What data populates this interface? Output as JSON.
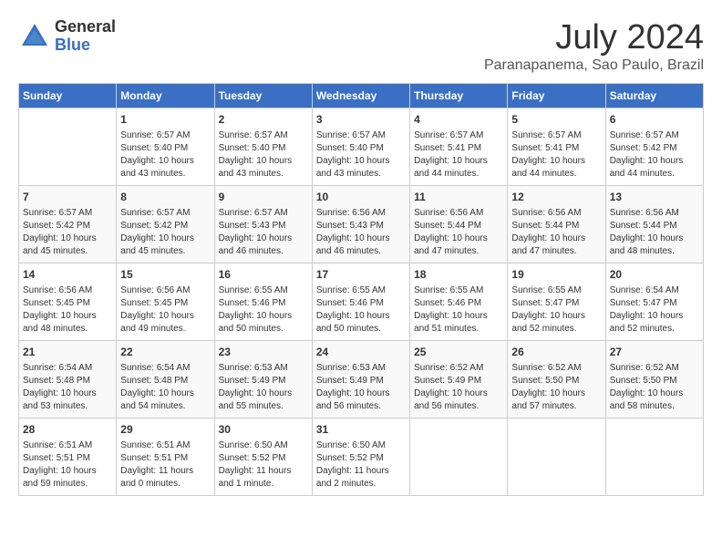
{
  "header": {
    "logo_general": "General",
    "logo_blue": "Blue",
    "month_year": "July 2024",
    "location": "Paranapanema, Sao Paulo, Brazil"
  },
  "days_of_week": [
    "Sunday",
    "Monday",
    "Tuesday",
    "Wednesday",
    "Thursday",
    "Friday",
    "Saturday"
  ],
  "weeks": [
    [
      {
        "day": "",
        "info": ""
      },
      {
        "day": "1",
        "info": "Sunrise: 6:57 AM\nSunset: 5:40 PM\nDaylight: 10 hours\nand 43 minutes."
      },
      {
        "day": "2",
        "info": "Sunrise: 6:57 AM\nSunset: 5:40 PM\nDaylight: 10 hours\nand 43 minutes."
      },
      {
        "day": "3",
        "info": "Sunrise: 6:57 AM\nSunset: 5:40 PM\nDaylight: 10 hours\nand 43 minutes."
      },
      {
        "day": "4",
        "info": "Sunrise: 6:57 AM\nSunset: 5:41 PM\nDaylight: 10 hours\nand 44 minutes."
      },
      {
        "day": "5",
        "info": "Sunrise: 6:57 AM\nSunset: 5:41 PM\nDaylight: 10 hours\nand 44 minutes."
      },
      {
        "day": "6",
        "info": "Sunrise: 6:57 AM\nSunset: 5:42 PM\nDaylight: 10 hours\nand 44 minutes."
      }
    ],
    [
      {
        "day": "7",
        "info": "Sunrise: 6:57 AM\nSunset: 5:42 PM\nDaylight: 10 hours\nand 45 minutes."
      },
      {
        "day": "8",
        "info": "Sunrise: 6:57 AM\nSunset: 5:42 PM\nDaylight: 10 hours\nand 45 minutes."
      },
      {
        "day": "9",
        "info": "Sunrise: 6:57 AM\nSunset: 5:43 PM\nDaylight: 10 hours\nand 46 minutes."
      },
      {
        "day": "10",
        "info": "Sunrise: 6:56 AM\nSunset: 5:43 PM\nDaylight: 10 hours\nand 46 minutes."
      },
      {
        "day": "11",
        "info": "Sunrise: 6:56 AM\nSunset: 5:44 PM\nDaylight: 10 hours\nand 47 minutes."
      },
      {
        "day": "12",
        "info": "Sunrise: 6:56 AM\nSunset: 5:44 PM\nDaylight: 10 hours\nand 47 minutes."
      },
      {
        "day": "13",
        "info": "Sunrise: 6:56 AM\nSunset: 5:44 PM\nDaylight: 10 hours\nand 48 minutes."
      }
    ],
    [
      {
        "day": "14",
        "info": "Sunrise: 6:56 AM\nSunset: 5:45 PM\nDaylight: 10 hours\nand 48 minutes."
      },
      {
        "day": "15",
        "info": "Sunrise: 6:56 AM\nSunset: 5:45 PM\nDaylight: 10 hours\nand 49 minutes."
      },
      {
        "day": "16",
        "info": "Sunrise: 6:55 AM\nSunset: 5:46 PM\nDaylight: 10 hours\nand 50 minutes."
      },
      {
        "day": "17",
        "info": "Sunrise: 6:55 AM\nSunset: 5:46 PM\nDaylight: 10 hours\nand 50 minutes."
      },
      {
        "day": "18",
        "info": "Sunrise: 6:55 AM\nSunset: 5:46 PM\nDaylight: 10 hours\nand 51 minutes."
      },
      {
        "day": "19",
        "info": "Sunrise: 6:55 AM\nSunset: 5:47 PM\nDaylight: 10 hours\nand 52 minutes."
      },
      {
        "day": "20",
        "info": "Sunrise: 6:54 AM\nSunset: 5:47 PM\nDaylight: 10 hours\nand 52 minutes."
      }
    ],
    [
      {
        "day": "21",
        "info": "Sunrise: 6:54 AM\nSunset: 5:48 PM\nDaylight: 10 hours\nand 53 minutes."
      },
      {
        "day": "22",
        "info": "Sunrise: 6:54 AM\nSunset: 5:48 PM\nDaylight: 10 hours\nand 54 minutes."
      },
      {
        "day": "23",
        "info": "Sunrise: 6:53 AM\nSunset: 5:49 PM\nDaylight: 10 hours\nand 55 minutes."
      },
      {
        "day": "24",
        "info": "Sunrise: 6:53 AM\nSunset: 5:49 PM\nDaylight: 10 hours\nand 56 minutes."
      },
      {
        "day": "25",
        "info": "Sunrise: 6:52 AM\nSunset: 5:49 PM\nDaylight: 10 hours\nand 56 minutes."
      },
      {
        "day": "26",
        "info": "Sunrise: 6:52 AM\nSunset: 5:50 PM\nDaylight: 10 hours\nand 57 minutes."
      },
      {
        "day": "27",
        "info": "Sunrise: 6:52 AM\nSunset: 5:50 PM\nDaylight: 10 hours\nand 58 minutes."
      }
    ],
    [
      {
        "day": "28",
        "info": "Sunrise: 6:51 AM\nSunset: 5:51 PM\nDaylight: 10 hours\nand 59 minutes."
      },
      {
        "day": "29",
        "info": "Sunrise: 6:51 AM\nSunset: 5:51 PM\nDaylight: 11 hours\nand 0 minutes."
      },
      {
        "day": "30",
        "info": "Sunrise: 6:50 AM\nSunset: 5:52 PM\nDaylight: 11 hours\nand 1 minute."
      },
      {
        "day": "31",
        "info": "Sunrise: 6:50 AM\nSunset: 5:52 PM\nDaylight: 11 hours\nand 2 minutes."
      },
      {
        "day": "",
        "info": ""
      },
      {
        "day": "",
        "info": ""
      },
      {
        "day": "",
        "info": ""
      }
    ]
  ]
}
